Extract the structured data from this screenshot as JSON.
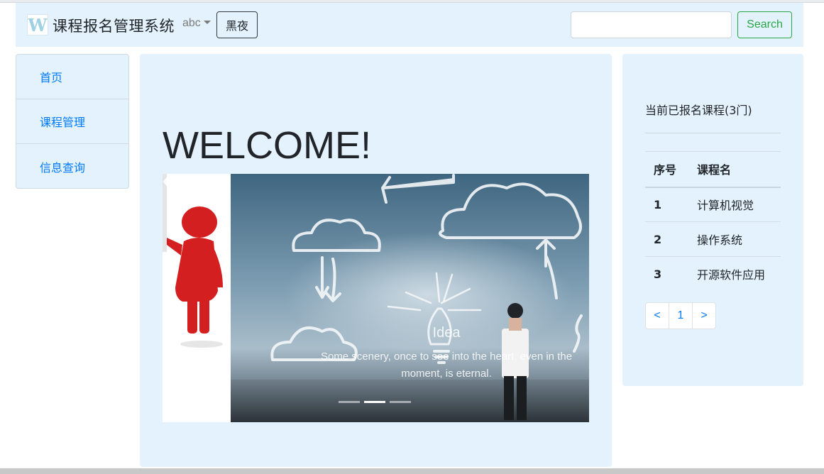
{
  "navbar": {
    "brand_title": "课程报名管理系统",
    "logo_letter": "W",
    "dropdown_label": "abc",
    "night_button": "黑夜",
    "search": {
      "value": "",
      "placeholder": ""
    },
    "search_button": "Search"
  },
  "sidebar": {
    "items": [
      {
        "label": "首页"
      },
      {
        "label": "课程管理"
      },
      {
        "label": "信息查询"
      }
    ]
  },
  "main": {
    "heading": "WELCOME!",
    "carousel": {
      "caption_title": "Idea",
      "caption_text": "Some scenery, once to see into the heart, even in the moment, is eternal.",
      "active_slide_index": 2,
      "slide_count": 3
    }
  },
  "enrolled": {
    "title": "当前已报名课程(3门)",
    "columns": [
      "序号",
      "课程名"
    ],
    "rows": [
      {
        "no": "1",
        "name": "计算机视觉"
      },
      {
        "no": "2",
        "name": "操作系统"
      },
      {
        "no": "3",
        "name": "开源软件应用"
      }
    ],
    "pagination": {
      "prev": "<",
      "page": "1",
      "next": ">"
    }
  },
  "colors": {
    "panel_bg": "#e3f2fd",
    "link": "#007bff",
    "success": "#28a745"
  }
}
